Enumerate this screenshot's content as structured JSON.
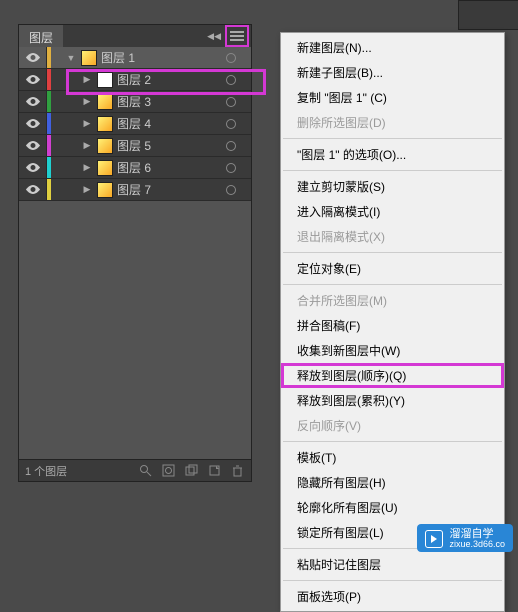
{
  "panel": {
    "tab": "图层",
    "footer": "1 个图层"
  },
  "layers": [
    {
      "name": "图层 1",
      "color": "#e0b040",
      "thumb": "grad",
      "tri": "down",
      "indent": 1
    },
    {
      "name": "图层  2",
      "color": "#e04040",
      "thumb": "white",
      "tri": "right",
      "indent": 2
    },
    {
      "name": "图层  3",
      "color": "#30a040",
      "thumb": "grad",
      "tri": "right",
      "indent": 2
    },
    {
      "name": "图层  4",
      "color": "#4060e0",
      "thumb": "grad",
      "tri": "right",
      "indent": 2
    },
    {
      "name": "图层  5",
      "color": "#d040d0",
      "thumb": "grad",
      "tri": "right",
      "indent": 2
    },
    {
      "name": "图层  6",
      "color": "#20d0d0",
      "thumb": "grad",
      "tri": "right",
      "indent": 2
    },
    {
      "name": "图层  7",
      "color": "#e0d040",
      "thumb": "grad",
      "tri": "right",
      "indent": 2
    }
  ],
  "menu": {
    "items": [
      {
        "label": "新建图层(N)...",
        "enabled": true
      },
      {
        "label": "新建子图层(B)...",
        "enabled": true
      },
      {
        "label": "复制 \"图层 1\" (C)",
        "enabled": true
      },
      {
        "label": "删除所选图层(D)",
        "enabled": false
      },
      {
        "sep": true
      },
      {
        "label": "\"图层 1\" 的选项(O)...",
        "enabled": true
      },
      {
        "sep": true
      },
      {
        "label": "建立剪切蒙版(S)",
        "enabled": true
      },
      {
        "label": "进入隔离模式(I)",
        "enabled": true
      },
      {
        "label": "退出隔离模式(X)",
        "enabled": false
      },
      {
        "sep": true
      },
      {
        "label": "定位对象(E)",
        "enabled": true
      },
      {
        "sep": true
      },
      {
        "label": "合并所选图层(M)",
        "enabled": false
      },
      {
        "label": "拼合图稿(F)",
        "enabled": true
      },
      {
        "label": "收集到新图层中(W)",
        "enabled": true
      },
      {
        "label": "释放到图层(顺序)(Q)",
        "enabled": true,
        "highlight": true
      },
      {
        "label": "释放到图层(累积)(Y)",
        "enabled": true
      },
      {
        "label": "反向顺序(V)",
        "enabled": false
      },
      {
        "sep": true
      },
      {
        "label": "模板(T)",
        "enabled": true
      },
      {
        "label": "隐藏所有图层(H)",
        "enabled": true
      },
      {
        "label": "轮廓化所有图层(U)",
        "enabled": true
      },
      {
        "label": "锁定所有图层(L)",
        "enabled": true
      },
      {
        "sep": true
      },
      {
        "label": "粘贴时记住图层",
        "enabled": true
      },
      {
        "sep": true
      },
      {
        "label": "面板选项(P)",
        "enabled": true
      }
    ]
  },
  "watermark": {
    "title": "溜溜自学",
    "url": "zixue.3d66.co"
  }
}
